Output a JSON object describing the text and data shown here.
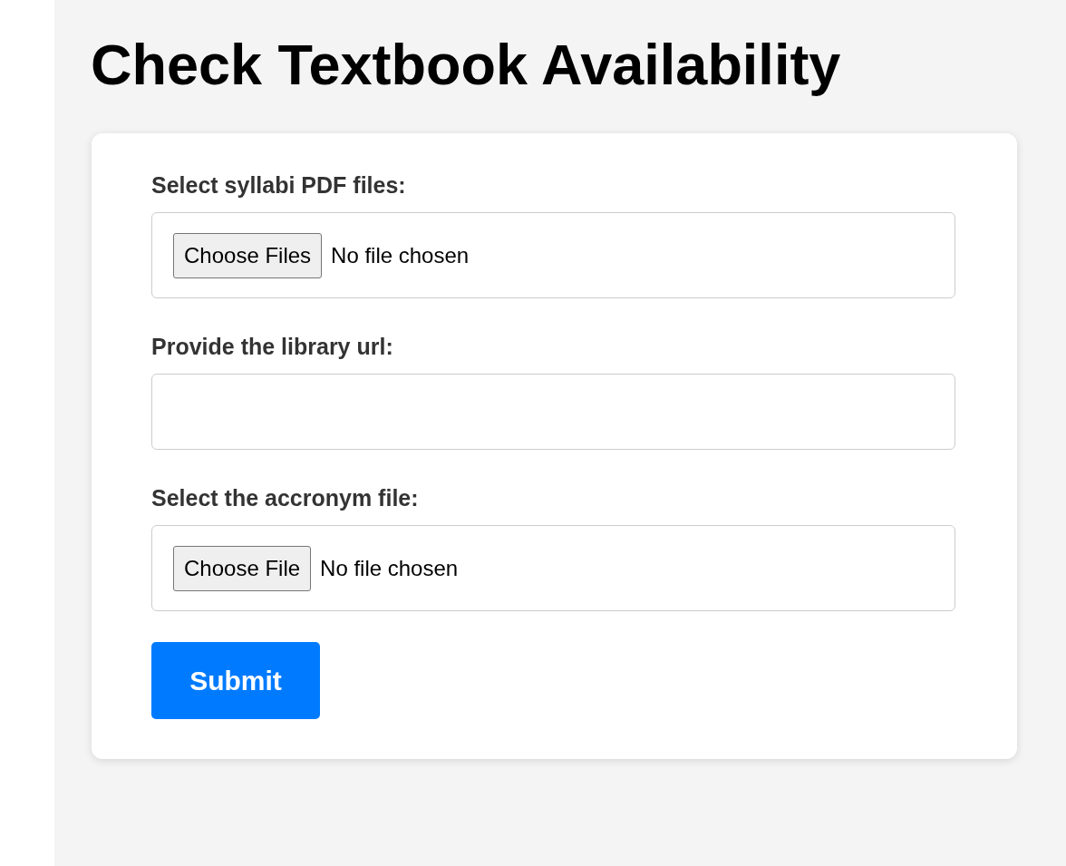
{
  "title": "Check Textbook Availability",
  "form": {
    "fields": [
      {
        "kind": "file",
        "label": "Select syllabi PDF files:",
        "button": "Choose Files",
        "status": "No file chosen"
      },
      {
        "kind": "text",
        "label": "Provide the library url:"
      },
      {
        "kind": "file",
        "label": "Select the accronym file:",
        "button": "Choose File",
        "status": "No file chosen"
      }
    ],
    "submit": "Submit"
  }
}
